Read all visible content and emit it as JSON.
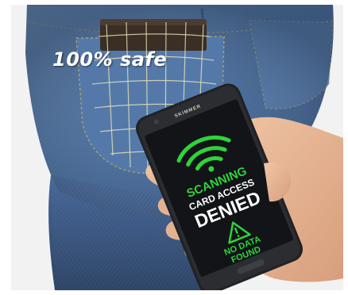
{
  "caption": "100% safe",
  "phone": {
    "brand": "SKIMMER",
    "screen": {
      "line1": "SCANNING",
      "line2": "CARD ACCESS",
      "line3": "DENIED",
      "line4": "NO DATA",
      "line5": "FOUND"
    }
  },
  "colors": {
    "accent_green": "#2fd33a",
    "denim": "#4f76a8",
    "screen_bg": "#121417"
  },
  "icons": [
    "wifi-signal-icon",
    "warning-triangle-icon"
  ]
}
